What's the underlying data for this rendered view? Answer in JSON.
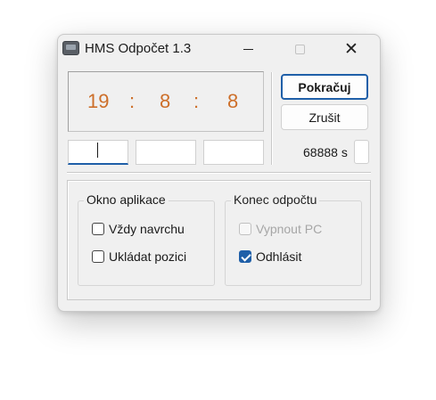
{
  "window": {
    "title": "HMS Odpočet 1.3",
    "icon": "app-icon",
    "controls": {
      "minimize": "minimize-icon",
      "maximize": "maximize-icon",
      "close": "close-icon",
      "close_glyph": "✕"
    }
  },
  "timer": {
    "hours": "19",
    "minutes": "8",
    "seconds": "8",
    "separator": ":"
  },
  "inputs": {
    "hours_value": "",
    "minutes_value": "",
    "seconds_value": ""
  },
  "buttons": {
    "continue": "Pokračuj",
    "cancel": "Zrušit"
  },
  "total_seconds": "68888 s",
  "options": {
    "app_window": {
      "title": "Okno aplikace",
      "always_on_top": {
        "label": "Vždy navrchu",
        "checked": false
      },
      "save_position": {
        "label": "Ukládat pozici",
        "checked": false
      }
    },
    "countdown_end": {
      "title": "Konec odpočtu",
      "shutdown_pc": {
        "label": "Vypnout PC",
        "checked": false,
        "disabled": true
      },
      "log_off": {
        "label": "Odhlásit",
        "checked": true
      }
    }
  },
  "colors": {
    "timer_text": "#cd6f2a",
    "accent": "#1f5fa8",
    "window_bg": "#f0f0f0"
  }
}
